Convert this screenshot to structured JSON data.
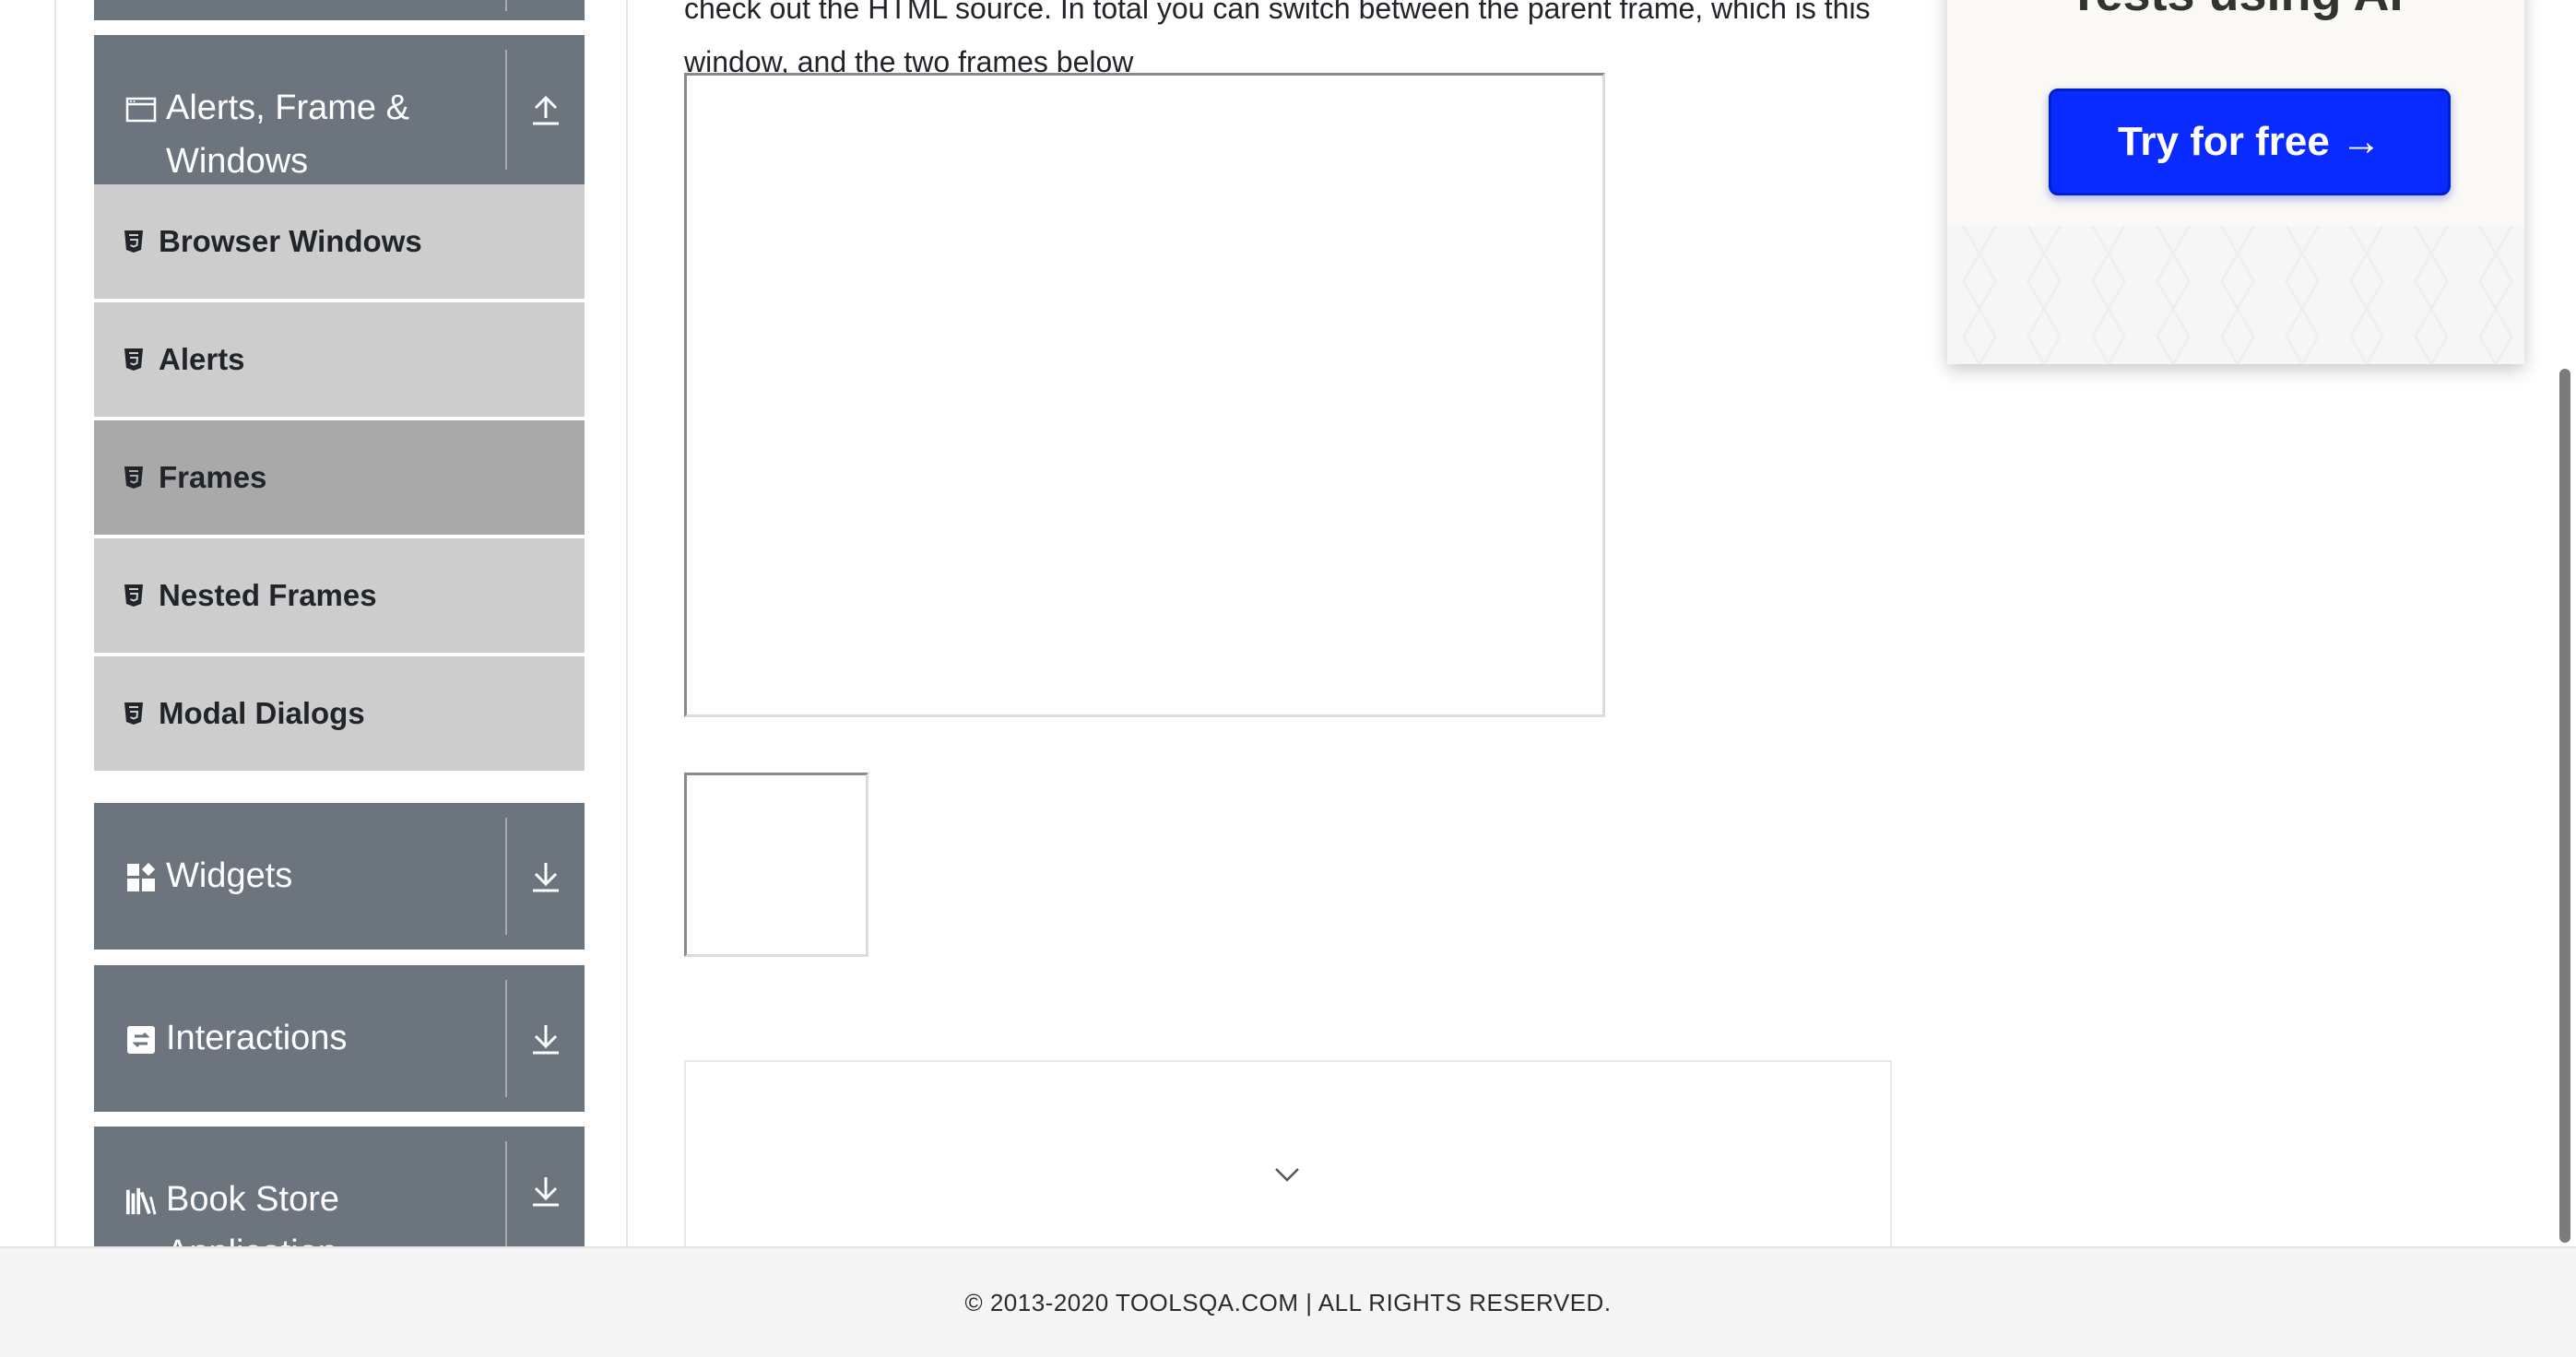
{
  "main": {
    "intro_text": "check out the HTML source. In total you can switch between the parent frame, which is this window, and the two frames below"
  },
  "sidebar": {
    "groups": [
      {
        "title": "Alerts, Frame & Windows",
        "icon": "window-icon",
        "toggle_icon": "upload-arrow-icon"
      },
      {
        "title": "Widgets",
        "icon": "widgets-icon",
        "toggle_icon": "download-arrow-icon"
      },
      {
        "title": "Interactions",
        "icon": "interactions-icon",
        "toggle_icon": "download-arrow-icon"
      },
      {
        "title": "Book Store Application",
        "icon": "books-icon",
        "toggle_icon": "download-arrow-icon"
      }
    ],
    "items": [
      {
        "label": "Browser Windows",
        "icon": "html5-icon"
      },
      {
        "label": "Alerts",
        "icon": "html5-icon"
      },
      {
        "label": "Frames",
        "icon": "html5-icon",
        "active": true
      },
      {
        "label": "Nested Frames",
        "icon": "html5-icon"
      },
      {
        "label": "Modal Dialogs",
        "icon": "html5-icon"
      }
    ]
  },
  "ad": {
    "headline": "Tests using AI",
    "button_label": "Try for free →",
    "button_color": "#0a2bff"
  },
  "footer": {
    "text": "© 2013-2020 TOOLSQA.COM | ALL RIGHTS RESERVED."
  },
  "colors": {
    "group_header_bg": "#6c757d",
    "menu_item_bg": "#cdcdcd",
    "menu_item_active_bg": "#a9a9a9"
  }
}
